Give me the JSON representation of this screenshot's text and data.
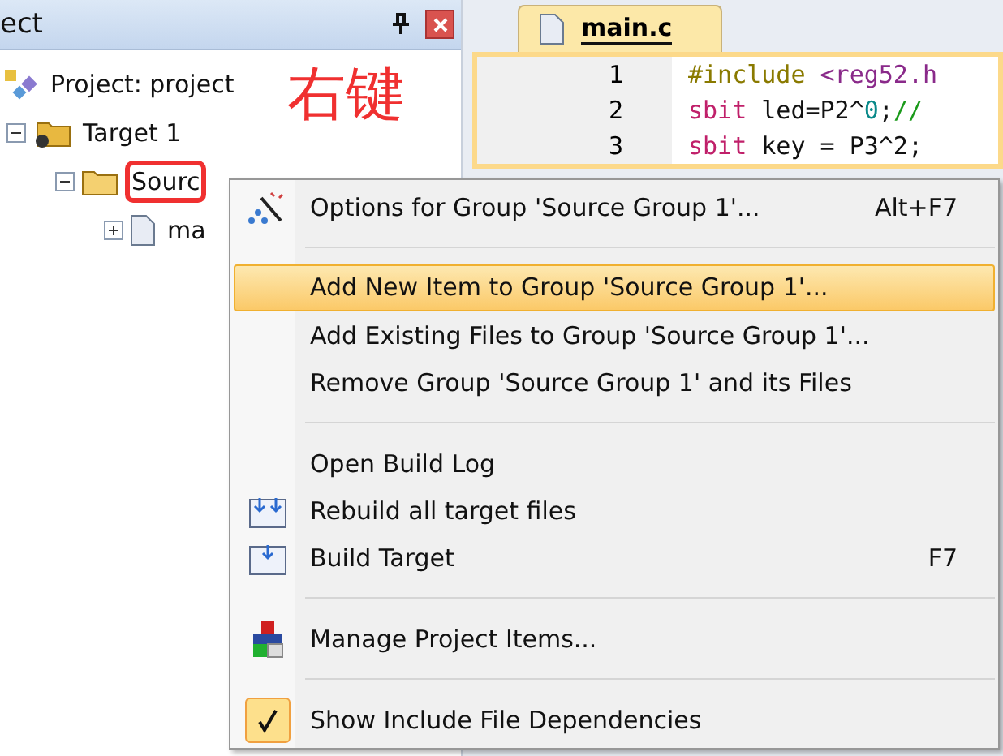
{
  "project_panel": {
    "title": "ect",
    "tree": [
      {
        "label": "Project: project",
        "kind": "project",
        "children": [
          {
            "label": "Target 1",
            "kind": "target",
            "expanded": true,
            "children": [
              {
                "label": "Sourc",
                "kind": "folder",
                "expanded": true,
                "highlighted": true,
                "children": [
                  {
                    "label": "ma",
                    "kind": "file",
                    "expanded": false
                  }
                ]
              }
            ]
          }
        ]
      }
    ]
  },
  "annotation": "右键",
  "editor": {
    "tabs": [
      {
        "label": "main.c",
        "selected": true
      }
    ],
    "lines": [
      {
        "number": "1",
        "tokens": [
          {
            "kind": "preprocessor",
            "text": "#include"
          },
          {
            "kind": "string",
            "text": " <reg52.h"
          }
        ]
      },
      {
        "number": "2",
        "tokens": [
          {
            "kind": "keyword",
            "text": "sbit"
          },
          {
            "kind": "plain",
            "text": " led=P2^"
          },
          {
            "kind": "number",
            "text": "0"
          },
          {
            "kind": "plain",
            "text": ";"
          },
          {
            "kind": "comment",
            "text": "//"
          }
        ]
      },
      {
        "number": "3",
        "tokens": [
          {
            "kind": "keyword",
            "text": "sbit"
          },
          {
            "kind": "plain",
            "text": " key = P3^2;"
          }
        ]
      }
    ]
  },
  "context_menu": [
    {
      "kind": "wand",
      "label": "Options for Group 'Source Group 1'...",
      "shortcut": "Alt+F7",
      "selected": false,
      "checked": false
    },
    {
      "kind": "separator"
    },
    {
      "kind": "plain",
      "label": "Add New  Item to Group 'Source Group 1'...",
      "selected": true,
      "checked": false
    },
    {
      "kind": "plain",
      "label": "Add Existing Files to Group 'Source Group 1'...",
      "selected": false,
      "checked": false
    },
    {
      "kind": "plain",
      "label": "Remove Group 'Source Group 1' and its Files",
      "selected": false,
      "checked": false
    },
    {
      "kind": "separator"
    },
    {
      "kind": "plain",
      "label": "Open Build Log",
      "selected": false,
      "checked": false
    },
    {
      "kind": "rebuild",
      "label": "Rebuild all target files",
      "selected": false,
      "checked": false
    },
    {
      "kind": "build",
      "label": "Build Target",
      "shortcut": "F7",
      "selected": false,
      "checked": false
    },
    {
      "kind": "separator"
    },
    {
      "kind": "blocks",
      "label": "Manage Project Items...",
      "selected": false,
      "checked": false
    },
    {
      "kind": "separator"
    },
    {
      "kind": "plain",
      "label": "Show Include File Dependencies",
      "selected": false,
      "checked": true
    }
  ]
}
